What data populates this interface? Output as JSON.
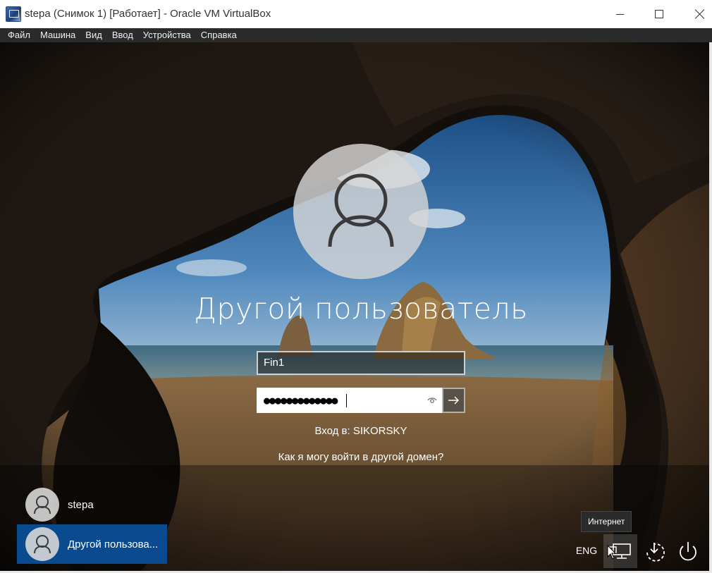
{
  "window": {
    "title": "stepa (Снимок 1) [Работает] - Oracle VM VirtualBox",
    "icon": "virtualbox-icon"
  },
  "menu": {
    "items": [
      "Файл",
      "Машина",
      "Вид",
      "Ввод",
      "Устройства",
      "Справка"
    ]
  },
  "login": {
    "heading": "Другой пользователь",
    "username_value": "Fin1",
    "password_mask": "●●●●●●●●●●●●●",
    "sign_in_to": "Вход в: SIKORSKY",
    "domain_help_link": "Как я могу войти в другой домен?"
  },
  "users": [
    {
      "label": "stepa",
      "selected": false
    },
    {
      "label": "Другой пользова...",
      "selected": true
    }
  ],
  "tray": {
    "language": "ENG",
    "tooltip": "Интернет",
    "icons": [
      "network-icon",
      "ease-of-access-icon",
      "power-icon"
    ]
  },
  "colors": {
    "selected_tile": "#0a4b8f",
    "menubar": "#2b2b2b"
  }
}
